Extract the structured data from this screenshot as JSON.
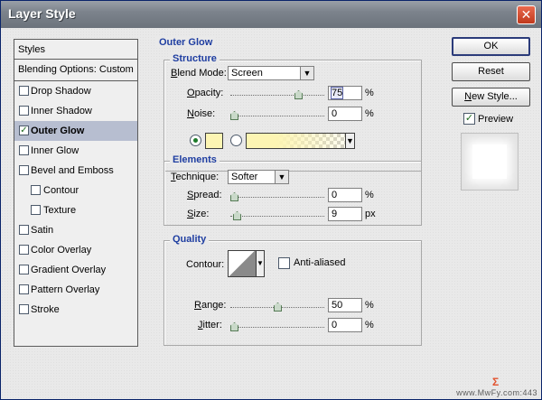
{
  "window": {
    "title": "Layer Style"
  },
  "styles_list": {
    "header": "Styles",
    "blending_options": "Blending Options: Custom",
    "items": [
      {
        "label": "Drop Shadow",
        "checked": false,
        "sub": false,
        "active": false
      },
      {
        "label": "Inner Shadow",
        "checked": false,
        "sub": false,
        "active": false
      },
      {
        "label": "Outer Glow",
        "checked": true,
        "sub": false,
        "active": true
      },
      {
        "label": "Inner Glow",
        "checked": false,
        "sub": false,
        "active": false
      },
      {
        "label": "Bevel and Emboss",
        "checked": false,
        "sub": false,
        "active": false
      },
      {
        "label": "Contour",
        "checked": false,
        "sub": true,
        "active": false
      },
      {
        "label": "Texture",
        "checked": false,
        "sub": true,
        "active": false
      },
      {
        "label": "Satin",
        "checked": false,
        "sub": false,
        "active": false
      },
      {
        "label": "Color Overlay",
        "checked": false,
        "sub": false,
        "active": false
      },
      {
        "label": "Gradient Overlay",
        "checked": false,
        "sub": false,
        "active": false
      },
      {
        "label": "Pattern Overlay",
        "checked": false,
        "sub": false,
        "active": false
      },
      {
        "label": "Stroke",
        "checked": false,
        "sub": false,
        "active": false
      }
    ]
  },
  "outer_glow": {
    "title": "Outer Glow",
    "structure": {
      "title": "Structure",
      "blend_mode_label": "Blend Mode:",
      "blend_mode_value": "Screen",
      "opacity_label": "Opacity:",
      "opacity_value": "75",
      "opacity_unit": "%",
      "opacity_level": 0.75,
      "noise_label": "Noise:",
      "noise_value": "0",
      "noise_unit": "%",
      "noise_level": 0,
      "glow_color": "#fdf5b3"
    },
    "elements": {
      "title": "Elements",
      "technique_label": "Technique:",
      "technique_value": "Softer",
      "spread_label": "Spread:",
      "spread_value": "0",
      "spread_unit": "%",
      "spread_level": 0,
      "size_label": "Size:",
      "size_value": "9",
      "size_unit": "px",
      "size_level": 0.036
    },
    "quality": {
      "title": "Quality",
      "contour_label": "Contour:",
      "anti_aliased_label": "Anti-aliased",
      "anti_aliased_checked": false,
      "range_label": "Range:",
      "range_value": "50",
      "range_unit": "%",
      "range_level": 0.5,
      "jitter_label": "Jitter:",
      "jitter_value": "0",
      "jitter_unit": "%",
      "jitter_level": 0
    }
  },
  "buttons": {
    "ok": "OK",
    "reset": "Reset",
    "new_style": "New Style...",
    "preview_label": "Preview",
    "preview_checked": true
  },
  "watermark": {
    "text": "www.MwFy.com:443"
  }
}
